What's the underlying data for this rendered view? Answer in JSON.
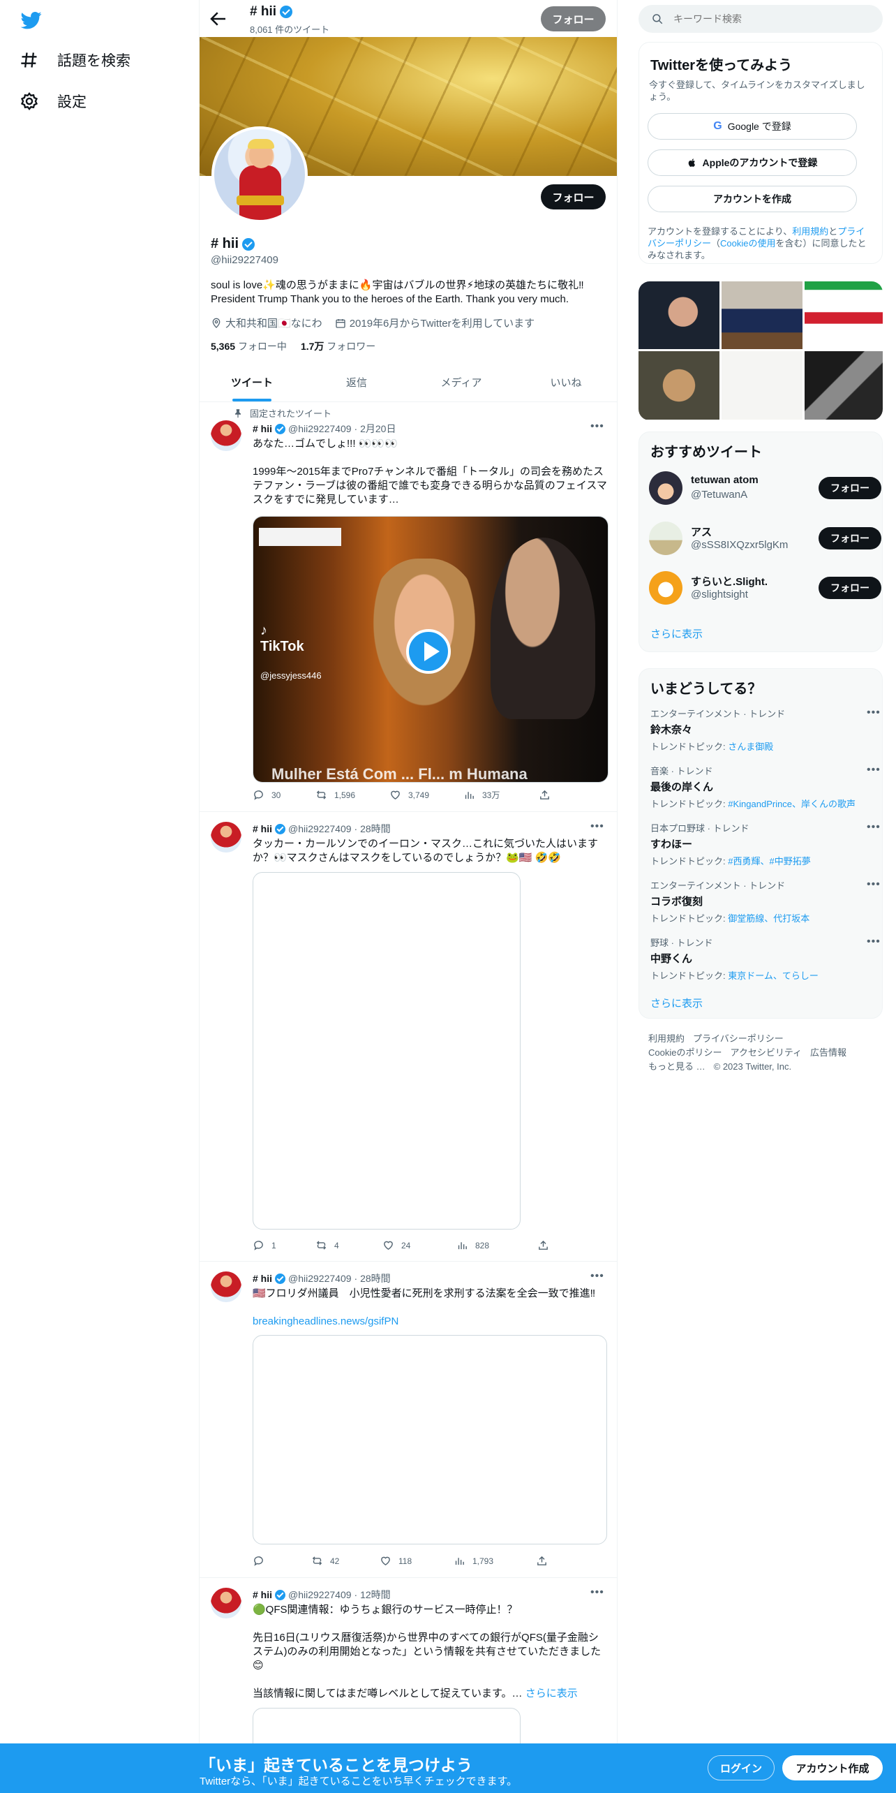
{
  "nav": {
    "explore": "話題を検索",
    "settings": "設定"
  },
  "topbar": {
    "name": "# hii",
    "tweet_count": "8,061 件のツイート",
    "follow": "フォロー"
  },
  "profile": {
    "follow": "フォロー",
    "name": "# hii",
    "handle": "@hii29227409",
    "bio": "soul is love✨魂の思うがままに🔥宇宙はバブルの世界⚡地球の英雄たちに敬礼‼\nPresident Trump Thank you to the heroes of the Earth. Thank you very much.",
    "location": "大和共和国🇯🇵なにわ",
    "joined": "2019年6月からTwitterを利用しています",
    "following_count": "5,365",
    "following_label": "フォロー中",
    "followers_count": "1.7万",
    "followers_label": "フォロワー"
  },
  "tabs": [
    "ツイート",
    "返信",
    "メディア",
    "いいね"
  ],
  "pinned_label": "固定されたツイート",
  "tweets": [
    {
      "name": "# hii",
      "handle": "@hii29227409",
      "time": "· 2月20日",
      "text": "あなた…ゴムでしょ!!! 👀👀👀\n\n1999年〜2015年までPro7チャンネルで番組「トータル」の司会を務めたステファン・ラーブは彼の番組で誰でも変身できる明らかな品質のフェイスマスクをすでに発見しています…",
      "video": {
        "tiktok": "TikTok",
        "tiktok_handle": "@jessyjess446",
        "caption": "Mulher Está Com ... Fl... m Humana"
      },
      "replies": "30",
      "retweets": "1,596",
      "likes": "3,749",
      "views": "33万"
    },
    {
      "name": "# hii",
      "handle": "@hii29227409",
      "time": "· 28時間",
      "text": "タッカー・カールソンでのイーロン・マスク…これに気づいた人はいますか？👀マスクさんはマスクをしているのでしょうか？🐸🇺🇸 🤣🤣",
      "replies": "1",
      "retweets": "4",
      "likes": "24",
      "views": "828"
    },
    {
      "name": "# hii",
      "handle": "@hii29227409",
      "time": "· 28時間",
      "text": "🇺🇸フロリダ州議員　小児性愛者に死刑を求刑する法案を全会一致で推進‼",
      "link": "breakingheadlines.news/gsifPN",
      "replies": "",
      "retweets": "42",
      "likes": "118",
      "views": "1,793"
    },
    {
      "name": "# hii",
      "handle": "@hii29227409",
      "time": "· 12時間",
      "text": "🟢QFS関連情報：ゆうちょ銀行のサービス一時停止！？\n\n先日16日(ユリウス暦復活祭)から世界中のすべての銀行がQFS(量子金融システム)のみの利用開始となった」という情報を共有させていただきました😊\n\n当該情報に関してはまだ噂レベルとして捉えています。…",
      "show_more": "さらに表示"
    }
  ],
  "search": {
    "placeholder": "キーワード検索"
  },
  "signup": {
    "title": "Twitterを使ってみよう",
    "subtitle": "今すぐ登録して、タイムラインをカスタマイズしましょう。",
    "google": "Google で登録",
    "apple": "Appleのアカウントで登録",
    "create": "アカウントを作成",
    "note_pre": "アカウントを登録することにより、",
    "note_terms": "利用規約",
    "note_and": "と",
    "note_privacy": "プライバシーポリシー",
    "note_cookie_pre": "（",
    "note_cookie": "Cookieの使用",
    "note_post": "を含む）に同意したとみなされます。"
  },
  "recommended": {
    "title": "おすすめツイート",
    "users": [
      {
        "name": "tetuwan atom",
        "handle": "@TetuwanA",
        "follow": "フォロー"
      },
      {
        "name": "アス",
        "handle": "@sSS8IXQzxr5lgKm",
        "follow": "フォロー"
      },
      {
        "name": "すらいと.Slight.",
        "handle": "@slightsight",
        "follow": "フォロー"
      }
    ],
    "show_more": "さらに表示"
  },
  "trends": {
    "title": "いまどうしてる？",
    "items": [
      {
        "category": "エンターテインメント · トレンド",
        "name": "鈴木奈々",
        "topic_label": "トレンドトピック:",
        "topic": "さんま御殿"
      },
      {
        "category": "音楽 · トレンド",
        "name": "最後の岸くん",
        "topic_label": "トレンドトピック:",
        "topic": "#KingandPrince、岸くんの歌声"
      },
      {
        "category": "日本プロ野球 · トレンド",
        "name": "すわほー",
        "topic_label": "トレンドトピック:",
        "topic": "#西勇輝、#中野拓夢"
      },
      {
        "category": "エンターテインメント · トレンド",
        "name": "コラボ復刻",
        "topic_label": "トレンドトピック:",
        "topic": "御堂筋線、代打坂本"
      },
      {
        "category": "野球 · トレンド",
        "name": "中野くん",
        "topic_label": "トレンドトピック:",
        "topic": "東京ドーム、てらしー"
      }
    ],
    "show_more": "さらに表示"
  },
  "footer": {
    "terms": "利用規約",
    "privacy": "プライバシーポリシー",
    "cookie": "Cookieのポリシー",
    "accessibility": "アクセシビリティ",
    "ads": "広告情報",
    "more": "もっと見る …",
    "copyright": "© 2023 Twitter, Inc."
  },
  "bottom": {
    "title": "「いま」起きていることを見つけよう",
    "subtitle": "Twitterなら、「いま」起きていることをいち早くチェックできます。",
    "login": "ログイン",
    "signup": "アカウント作成"
  },
  "colors": {
    "accent": "#1d9bf0",
    "text": "#0f1419",
    "muted": "#536471"
  }
}
